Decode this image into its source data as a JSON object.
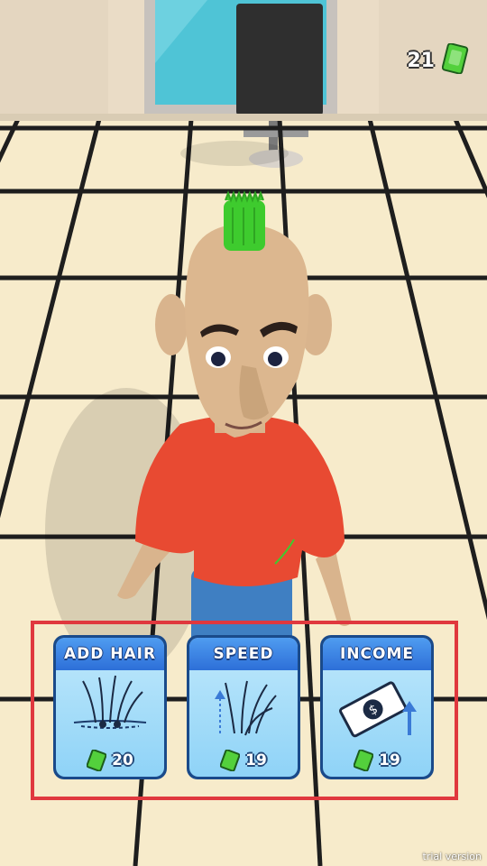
{
  "hud": {
    "cash": "21",
    "cash_icon": "cash-stack-icon"
  },
  "upgrades": [
    {
      "label": "ADD HAIR",
      "price": "20",
      "icon": "hair-follicle-icon"
    },
    {
      "label": "SPEED",
      "price": "19",
      "icon": "speed-hair-icon"
    },
    {
      "label": "INCOME",
      "price": "19",
      "icon": "money-bill-icon"
    }
  ],
  "watermark": "trial version",
  "colors": {
    "highlight": "#e0383e",
    "card_title": "#2d6fd8",
    "shirt": "#e84a32",
    "hair": "#3ecb2e"
  }
}
